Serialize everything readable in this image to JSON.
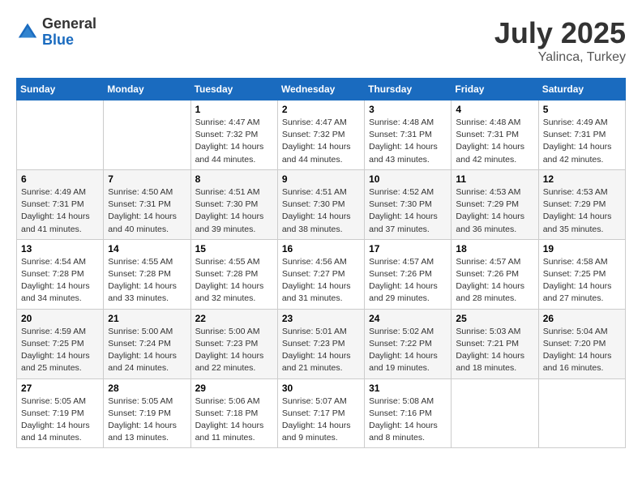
{
  "header": {
    "logo_general": "General",
    "logo_blue": "Blue",
    "month": "July 2025",
    "location": "Yalinca, Turkey"
  },
  "weekdays": [
    "Sunday",
    "Monday",
    "Tuesday",
    "Wednesday",
    "Thursday",
    "Friday",
    "Saturday"
  ],
  "weeks": [
    [
      {
        "day": "",
        "info": ""
      },
      {
        "day": "",
        "info": ""
      },
      {
        "day": "1",
        "sunrise": "4:47 AM",
        "sunset": "7:32 PM",
        "daylight": "14 hours and 44 minutes."
      },
      {
        "day": "2",
        "sunrise": "4:47 AM",
        "sunset": "7:32 PM",
        "daylight": "14 hours and 44 minutes."
      },
      {
        "day": "3",
        "sunrise": "4:48 AM",
        "sunset": "7:31 PM",
        "daylight": "14 hours and 43 minutes."
      },
      {
        "day": "4",
        "sunrise": "4:48 AM",
        "sunset": "7:31 PM",
        "daylight": "14 hours and 42 minutes."
      },
      {
        "day": "5",
        "sunrise": "4:49 AM",
        "sunset": "7:31 PM",
        "daylight": "14 hours and 42 minutes."
      }
    ],
    [
      {
        "day": "6",
        "sunrise": "4:49 AM",
        "sunset": "7:31 PM",
        "daylight": "14 hours and 41 minutes."
      },
      {
        "day": "7",
        "sunrise": "4:50 AM",
        "sunset": "7:31 PM",
        "daylight": "14 hours and 40 minutes."
      },
      {
        "day": "8",
        "sunrise": "4:51 AM",
        "sunset": "7:30 PM",
        "daylight": "14 hours and 39 minutes."
      },
      {
        "day": "9",
        "sunrise": "4:51 AM",
        "sunset": "7:30 PM",
        "daylight": "14 hours and 38 minutes."
      },
      {
        "day": "10",
        "sunrise": "4:52 AM",
        "sunset": "7:30 PM",
        "daylight": "14 hours and 37 minutes."
      },
      {
        "day": "11",
        "sunrise": "4:53 AM",
        "sunset": "7:29 PM",
        "daylight": "14 hours and 36 minutes."
      },
      {
        "day": "12",
        "sunrise": "4:53 AM",
        "sunset": "7:29 PM",
        "daylight": "14 hours and 35 minutes."
      }
    ],
    [
      {
        "day": "13",
        "sunrise": "4:54 AM",
        "sunset": "7:28 PM",
        "daylight": "14 hours and 34 minutes."
      },
      {
        "day": "14",
        "sunrise": "4:55 AM",
        "sunset": "7:28 PM",
        "daylight": "14 hours and 33 minutes."
      },
      {
        "day": "15",
        "sunrise": "4:55 AM",
        "sunset": "7:28 PM",
        "daylight": "14 hours and 32 minutes."
      },
      {
        "day": "16",
        "sunrise": "4:56 AM",
        "sunset": "7:27 PM",
        "daylight": "14 hours and 31 minutes."
      },
      {
        "day": "17",
        "sunrise": "4:57 AM",
        "sunset": "7:26 PM",
        "daylight": "14 hours and 29 minutes."
      },
      {
        "day": "18",
        "sunrise": "4:57 AM",
        "sunset": "7:26 PM",
        "daylight": "14 hours and 28 minutes."
      },
      {
        "day": "19",
        "sunrise": "4:58 AM",
        "sunset": "7:25 PM",
        "daylight": "14 hours and 27 minutes."
      }
    ],
    [
      {
        "day": "20",
        "sunrise": "4:59 AM",
        "sunset": "7:25 PM",
        "daylight": "14 hours and 25 minutes."
      },
      {
        "day": "21",
        "sunrise": "5:00 AM",
        "sunset": "7:24 PM",
        "daylight": "14 hours and 24 minutes."
      },
      {
        "day": "22",
        "sunrise": "5:00 AM",
        "sunset": "7:23 PM",
        "daylight": "14 hours and 22 minutes."
      },
      {
        "day": "23",
        "sunrise": "5:01 AM",
        "sunset": "7:23 PM",
        "daylight": "14 hours and 21 minutes."
      },
      {
        "day": "24",
        "sunrise": "5:02 AM",
        "sunset": "7:22 PM",
        "daylight": "14 hours and 19 minutes."
      },
      {
        "day": "25",
        "sunrise": "5:03 AM",
        "sunset": "7:21 PM",
        "daylight": "14 hours and 18 minutes."
      },
      {
        "day": "26",
        "sunrise": "5:04 AM",
        "sunset": "7:20 PM",
        "daylight": "14 hours and 16 minutes."
      }
    ],
    [
      {
        "day": "27",
        "sunrise": "5:05 AM",
        "sunset": "7:19 PM",
        "daylight": "14 hours and 14 minutes."
      },
      {
        "day": "28",
        "sunrise": "5:05 AM",
        "sunset": "7:19 PM",
        "daylight": "14 hours and 13 minutes."
      },
      {
        "day": "29",
        "sunrise": "5:06 AM",
        "sunset": "7:18 PM",
        "daylight": "14 hours and 11 minutes."
      },
      {
        "day": "30",
        "sunrise": "5:07 AM",
        "sunset": "7:17 PM",
        "daylight": "14 hours and 9 minutes."
      },
      {
        "day": "31",
        "sunrise": "5:08 AM",
        "sunset": "7:16 PM",
        "daylight": "14 hours and 8 minutes."
      },
      {
        "day": "",
        "info": ""
      },
      {
        "day": "",
        "info": ""
      }
    ]
  ]
}
